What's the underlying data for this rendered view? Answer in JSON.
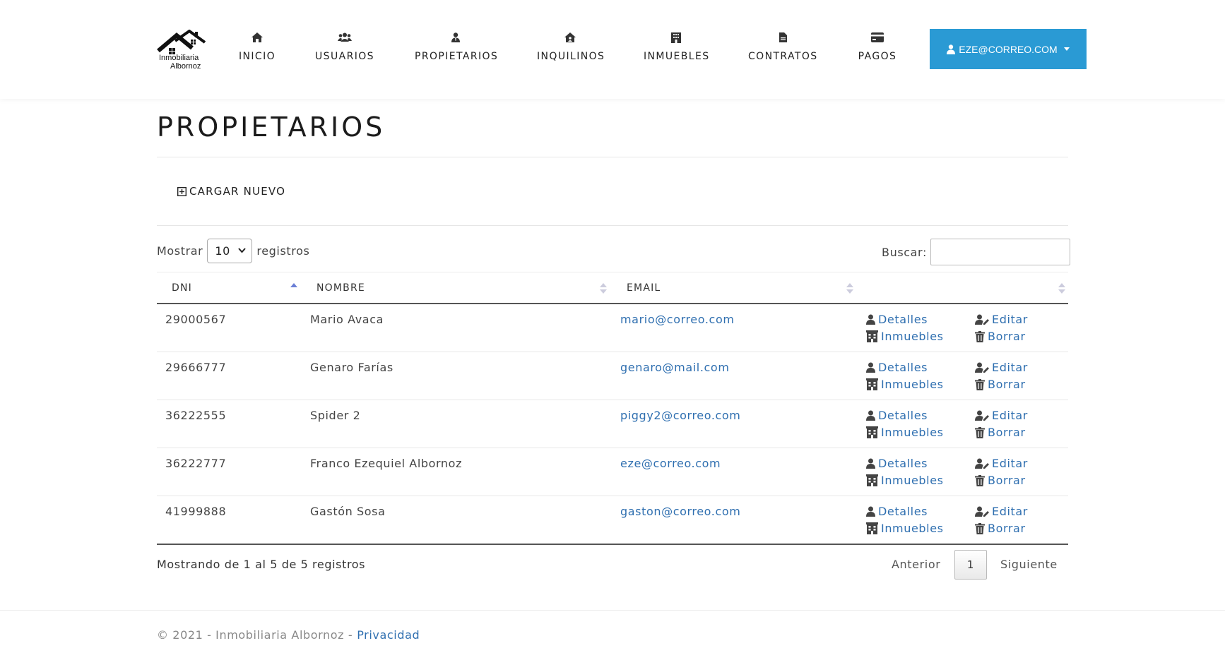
{
  "brand": {
    "line1": "Inmobiliaria",
    "line2": "Albornoz"
  },
  "nav": [
    {
      "label": "INICIO",
      "icon": "home-icon"
    },
    {
      "label": "USUARIOS",
      "icon": "users-icon"
    },
    {
      "label": "PROPIETARIOS",
      "icon": "user-tie-icon"
    },
    {
      "label": "INQUILINOS",
      "icon": "house-user-icon"
    },
    {
      "label": "INMUEBLES",
      "icon": "building-icon"
    },
    {
      "label": "CONTRATOS",
      "icon": "file-icon"
    },
    {
      "label": "PAGOS",
      "icon": "credit-card-icon"
    }
  ],
  "user_menu": {
    "label": "EZE@CORREO.COM"
  },
  "page": {
    "title": "PROPIETARIOS",
    "new_label": "CARGAR NUEVO"
  },
  "table_controls": {
    "show_prefix": "Mostrar",
    "show_value": "10",
    "show_suffix": "registros",
    "search_label": "Buscar:",
    "search_value": ""
  },
  "table": {
    "columns": [
      "DNI",
      "NOMBRE",
      "EMAIL",
      ""
    ],
    "sorted_column": "DNI",
    "actions": {
      "details": "Detalles",
      "edit": "Editar",
      "properties": "Inmuebles",
      "delete": "Borrar"
    },
    "rows": [
      {
        "dni": "29000567",
        "nombre": "Mario Avaca",
        "email": "mario@correo.com"
      },
      {
        "dni": "29666777",
        "nombre": "Genaro Farías",
        "email": "genaro@mail.com"
      },
      {
        "dni": "36222555",
        "nombre": "Spider 2",
        "email": "piggy2@correo.com"
      },
      {
        "dni": "36222777",
        "nombre": "Franco Ezequiel Albornoz",
        "email": "eze@correo.com"
      },
      {
        "dni": "41999888",
        "nombre": "Gastón Sosa",
        "email": "gaston@correo.com"
      }
    ]
  },
  "pagination": {
    "info": "Mostrando de 1 al 5 de 5 registros",
    "prev": "Anterior",
    "current": "1",
    "next": "Siguiente"
  },
  "footer": {
    "copyright": "© 2021 - Inmobiliaria Albornoz -",
    "privacy": "Privacidad"
  },
  "colors": {
    "accent": "#2a9ad4",
    "link": "#2f6fb0"
  }
}
